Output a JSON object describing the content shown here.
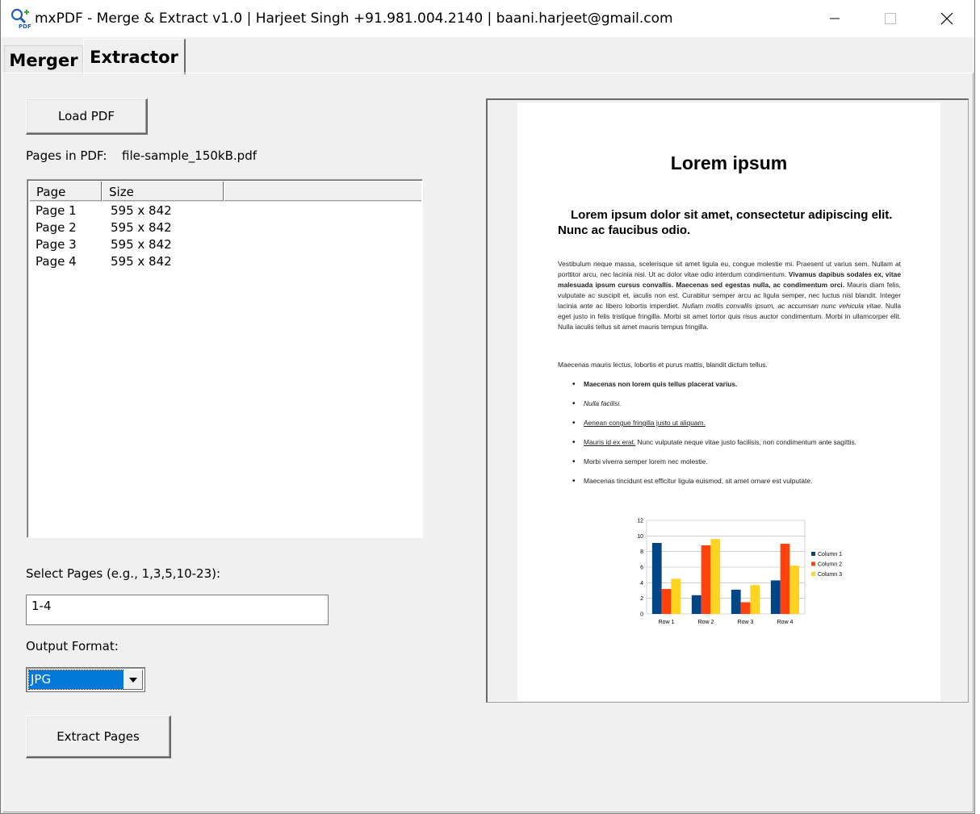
{
  "window": {
    "title": "mxPDF - Merge & Extract v1.0 | Harjeet Singh +91.981.004.2140 | baani.harjeet@gmail.com"
  },
  "tabs": [
    {
      "label": "Merger",
      "selected": false
    },
    {
      "label": "Extractor",
      "selected": true
    }
  ],
  "extractor": {
    "load_button_label": "Load PDF",
    "pages_in_pdf_label": "Pages in PDF:",
    "file_name": "file-sample_150kB.pdf",
    "list_columns": [
      "Page",
      "Size"
    ],
    "pages": [
      {
        "page": "Page 1",
        "size": "595 x 842"
      },
      {
        "page": "Page 2",
        "size": "595 x 842"
      },
      {
        "page": "Page 3",
        "size": "595 x 842"
      },
      {
        "page": "Page 4",
        "size": "595 x 842"
      }
    ],
    "select_pages_label": "Select Pages (e.g., 1,3,5,10-23):",
    "select_pages_value": "1-4",
    "output_format_label": "Output Format:",
    "output_format_value": "JPG",
    "extract_button_label": "Extract Pages"
  },
  "preview": {
    "title": "Lorem ipsum",
    "subtitle": "Lorem ipsum dolor sit amet, consectetur adipiscing elit. Nunc ac faucibus odio.",
    "para_a": "Vestibulum neque massa, scelerisque sit amet ligula eu, congue molestie mi. Praesent ut varius sem. Nullam at porttitor arcu, nec lacinia nisi. Ut ac dolor vitae odio interdum condimentum. ",
    "para_b_bold": "Vivamus dapibus sodales ex, vitae malesuada ipsum cursus convallis. Maecenas sed egestas nulla, ac condimentum orci.",
    "para_c": " Mauris diam felis, vulputate ac suscipit et, iaculis non est. Curabitur semper arcu ac ligula semper, nec luctus nisl blandit. Integer lacinia ante ac libero lobortis imperdiet. ",
    "para_d_italic": "Nullam mollis convallis ipsum, ac accumsan nunc vehicula vitae.",
    "para_e": " Nulla eget justo in felis tristique fringilla. Morbi sit amet tortor quis risus auctor condimentum. Morbi in ullamcorper elit. Nulla iaculis tellus sit amet mauris tempus fringilla.",
    "para2": "Maecenas mauris lectus, lobortis et purus mattis, blandit dictum tellus.",
    "bullet1": "Maecenas non lorem quis tellus placerat varius.",
    "bullet2": "Nulla facilisi.",
    "bullet3": "Aenean congue fringilla justo ut aliquam.",
    "bullet4_link": "Mauris id ex erat.",
    "bullet4_rest": " Nunc vulputate neque vitae justo facilisis, non condimentum ante sagittis.",
    "bullet5": "Morbi viverra semper lorem nec molestie.",
    "bullet6": "Maecenas tincidunt est efficitur ligula euismod, sit amet ornare est vulputate."
  },
  "chart_data": {
    "type": "bar",
    "categories": [
      "Row 1",
      "Row 2",
      "Row 3",
      "Row 4"
    ],
    "series": [
      {
        "name": "Column 1",
        "values": [
          9.1,
          2.4,
          3.1,
          4.3
        ],
        "color": "#004586"
      },
      {
        "name": "Column 2",
        "values": [
          3.2,
          8.8,
          1.5,
          9.0
        ],
        "color": "#ff420e"
      },
      {
        "name": "Column 3",
        "values": [
          4.5,
          9.6,
          3.7,
          6.2
        ],
        "color": "#ffd320"
      }
    ],
    "ylim": [
      0,
      12
    ],
    "yticks": [
      "0",
      "2",
      "4",
      "6",
      "8",
      "10",
      "12"
    ],
    "grid": true,
    "legend": "right"
  },
  "colors": {
    "selection": "#0078d7",
    "window_bg": "#f0f0f0"
  }
}
